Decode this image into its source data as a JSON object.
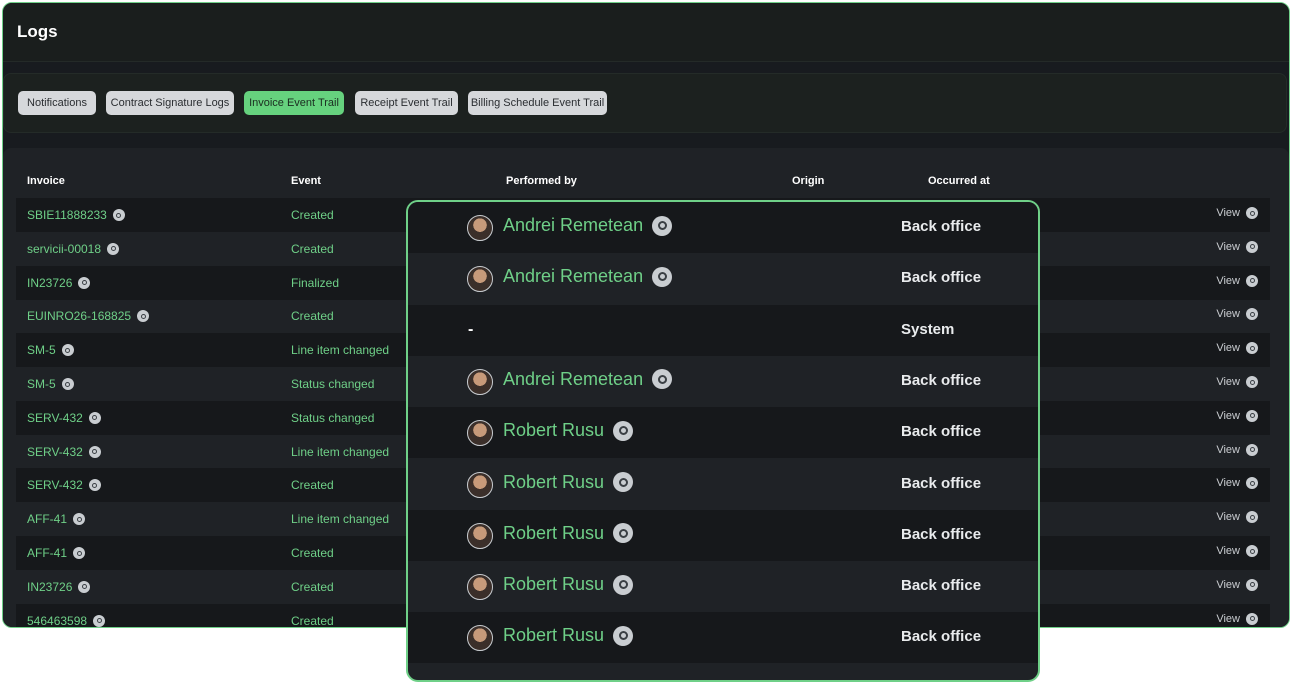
{
  "page": {
    "title": "Logs"
  },
  "tabs": [
    {
      "label": "Notifications",
      "active": false
    },
    {
      "label": "Contract Signature Logs",
      "active": false
    },
    {
      "label": "Invoice Event Trail",
      "active": true
    },
    {
      "label": "Receipt Event Trail",
      "active": false
    },
    {
      "label": "Billing Schedule Event Trail",
      "active": false
    }
  ],
  "table": {
    "columns": [
      "Invoice",
      "Event",
      "Performed by",
      "Origin",
      "Occurred at"
    ],
    "view_label": "View",
    "rows": [
      {
        "invoice": "SBIE11888233",
        "event": "Created"
      },
      {
        "invoice": "servicii-00018",
        "event": "Created"
      },
      {
        "invoice": "IN23726",
        "event": "Finalized"
      },
      {
        "invoice": "EUINRO26-168825",
        "event": "Created"
      },
      {
        "invoice": "SM-5",
        "event": "Line item changed"
      },
      {
        "invoice": "SM-5",
        "event": "Status changed"
      },
      {
        "invoice": "SERV-432",
        "event": "Status changed"
      },
      {
        "invoice": "SERV-432",
        "event": "Line item changed"
      },
      {
        "invoice": "SERV-432",
        "event": "Created"
      },
      {
        "invoice": "AFF-41",
        "event": "Line item changed"
      },
      {
        "invoice": "AFF-41",
        "event": "Created"
      },
      {
        "invoice": "IN23726",
        "event": "Created"
      },
      {
        "invoice": "546463598",
        "event": "Created"
      }
    ]
  },
  "zoom": {
    "rows": [
      {
        "performer": "Andrei Remetean",
        "origin": "Back office"
      },
      {
        "performer": "Andrei Remetean",
        "origin": "Back office"
      },
      {
        "performer": "-",
        "origin": "System"
      },
      {
        "performer": "Andrei Remetean",
        "origin": "Back office"
      },
      {
        "performer": "Robert Rusu",
        "origin": "Back office"
      },
      {
        "performer": "Robert Rusu",
        "origin": "Back office"
      },
      {
        "performer": "Robert Rusu",
        "origin": "Back office"
      },
      {
        "performer": "Robert Rusu",
        "origin": "Back office"
      },
      {
        "performer": "Robert Rusu",
        "origin": "Back office"
      }
    ]
  },
  "colors": {
    "accent": "#6fd088",
    "background": "#181b1f",
    "row_dark": "#16181b"
  }
}
